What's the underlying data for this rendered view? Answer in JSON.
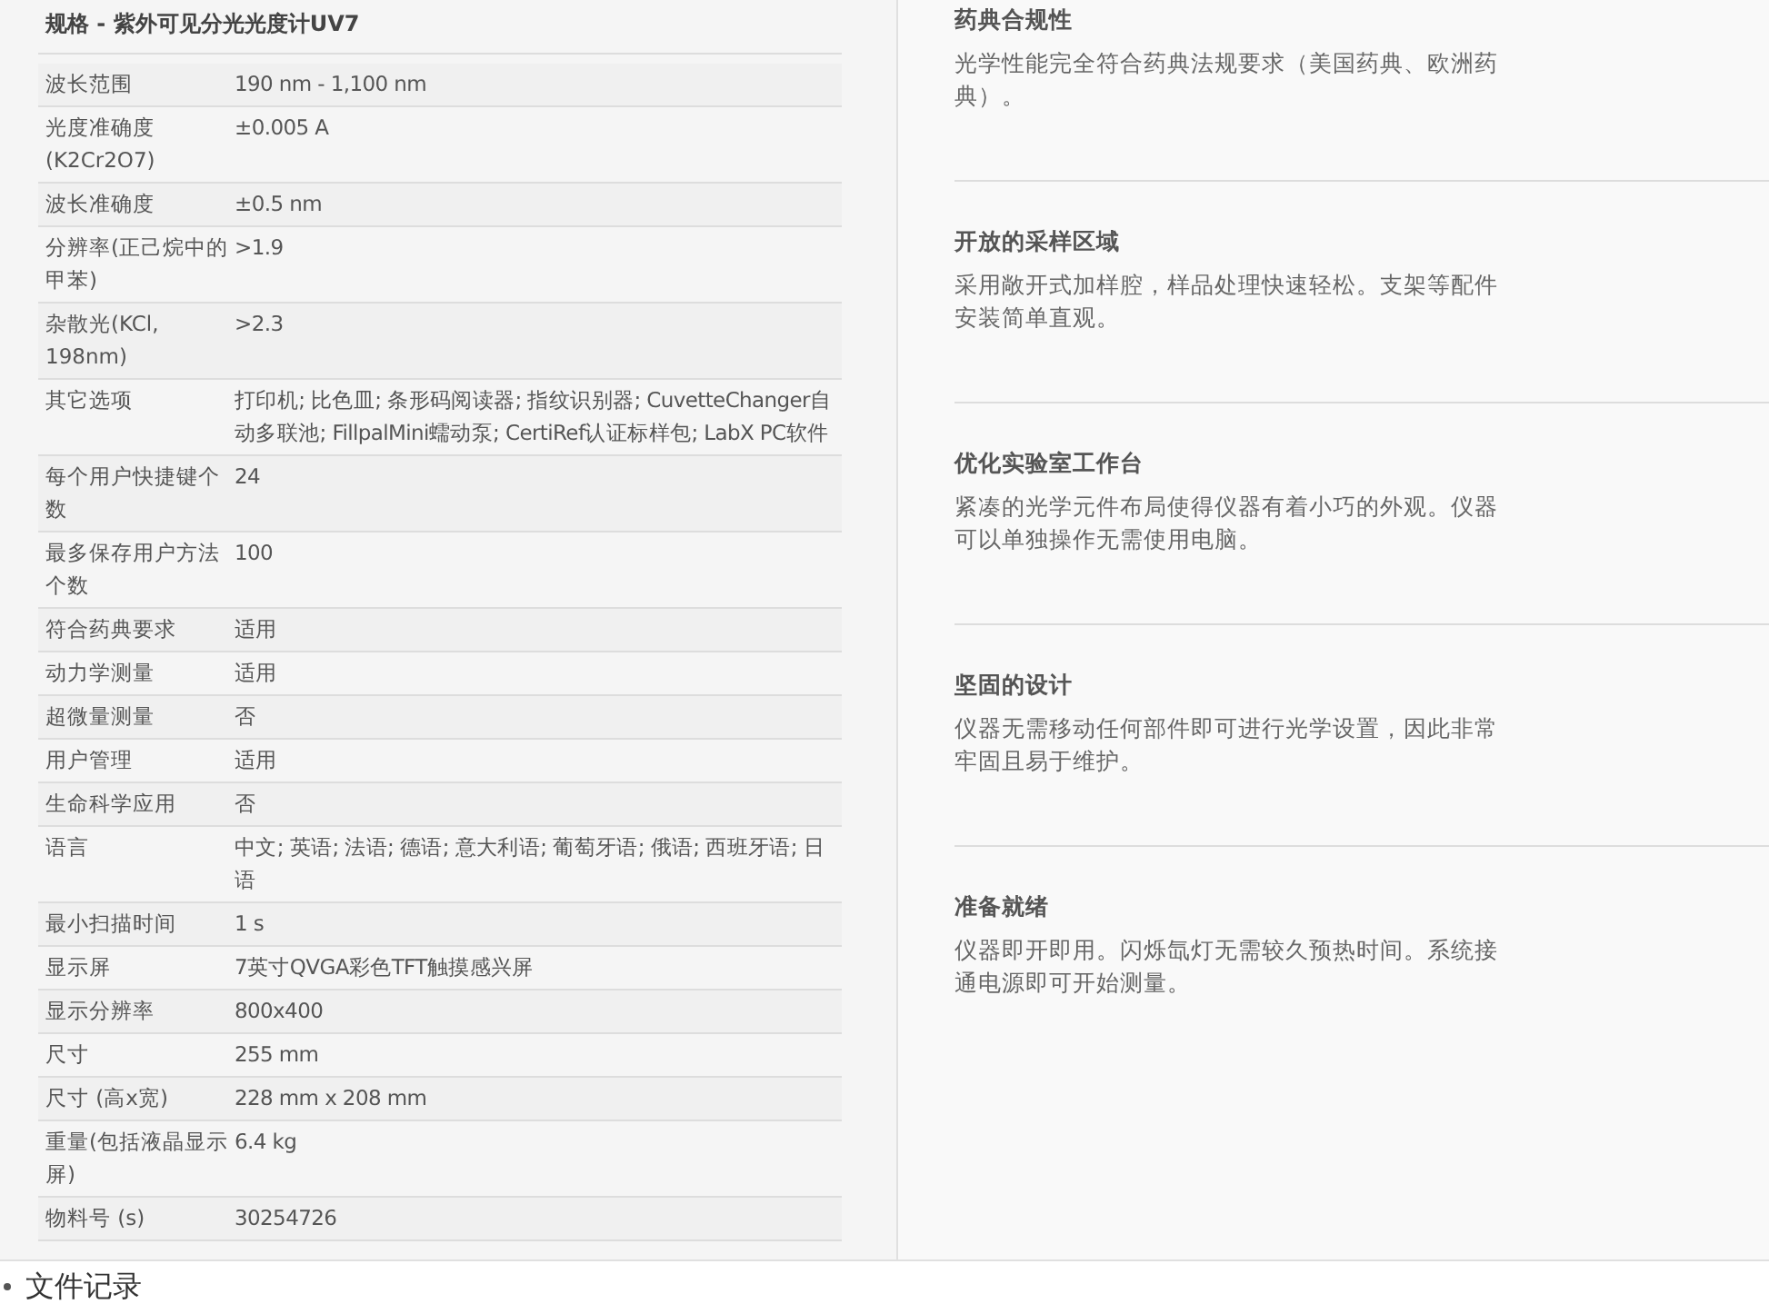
{
  "specs": {
    "title": "规格 - 紫外可见分光光度计UV7",
    "rows": [
      {
        "label": "波长范围",
        "value": "190 nm - 1,100 nm"
      },
      {
        "label": "光度准确度 (K2Cr2O7)",
        "value": "±0.005 A"
      },
      {
        "label": "波长准确度",
        "value": "±0.5 nm"
      },
      {
        "label": "分辨率(正己烷中的甲苯)",
        "value": ">1.9"
      },
      {
        "label": "杂散光(KCl, 198nm)",
        "value": ">2.3"
      },
      {
        "label": "其它选项",
        "value": "打印机; 比色皿; 条形码阅读器; 指纹识别器; CuvetteChanger自动多联池; FillpalMini蠕动泵; CertiRef认证标样包; LabX PC软件"
      },
      {
        "label": "每个用户快捷键个数",
        "value": "24"
      },
      {
        "label": "最多保存用户方法个数",
        "value": "100"
      },
      {
        "label": "符合药典要求",
        "value": "适用"
      },
      {
        "label": "动力学测量",
        "value": "适用"
      },
      {
        "label": "超微量测量",
        "value": "否"
      },
      {
        "label": "用户管理",
        "value": "适用"
      },
      {
        "label": "生命科学应用",
        "value": "否"
      },
      {
        "label": "语言",
        "value": "中文; 英语; 法语; 德语; 意大利语; 葡萄牙语; 俄语; 西班牙语; 日语"
      },
      {
        "label": "最小扫描时间",
        "value": "1 s"
      },
      {
        "label": "显示屏",
        "value": "7英寸QVGA彩色TFT触摸感兴屏"
      },
      {
        "label": "显示分辨率",
        "value": "800x400"
      },
      {
        "label": "尺寸",
        "value": "255 mm"
      },
      {
        "label": "尺寸 (高x宽)",
        "value": "228 mm x 208 mm"
      },
      {
        "label": "重量(包括液晶显示屏)",
        "value": "6.4 kg"
      },
      {
        "label": "物料号 (s)",
        "value": "30254726"
      }
    ]
  },
  "features": [
    {
      "title": "药典合规性",
      "text": "光学性能完全符合药典法规要求（美国药典、欧洲药典）。"
    },
    {
      "title": "开放的采样区域",
      "text": "采用敞开式加样腔，样品处理快速轻松。支架等配件安装简单直观。"
    },
    {
      "title": "优化实验室工作台",
      "text": "紧凑的光学元件布局使得仪器有着小巧的外观。仪器可以单独操作无需使用电脑。"
    },
    {
      "title": "坚固的设计",
      "text": "仪器无需移动任何部件即可进行光学设置，因此非常牢固且易于维护。"
    },
    {
      "title": "准备就绪",
      "text": "仪器即开即用。闪烁氙灯无需较久预热时间。系统接通电源即可开始测量。"
    }
  ],
  "next_section": {
    "title": "文件记录"
  }
}
